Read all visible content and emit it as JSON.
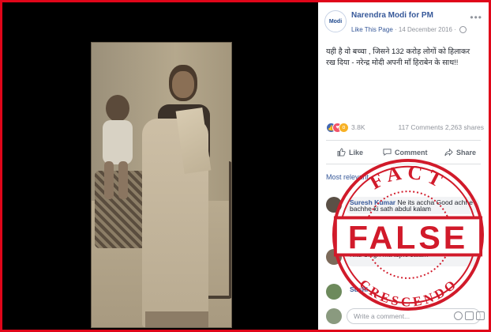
{
  "post": {
    "page_name": "Narendra Modi for PM",
    "logo_text": "Modi",
    "like_link": "Like This Page",
    "date": "· 14 December 2016 ·",
    "more_icon": "more-options-icon",
    "text": "यही है वो बच्चा , जिसने 132 करोड़ लोगों को हिलाकर रख दिया - नरेन्द्र मोदी अपनी माँ हिराबेन के साथ!!",
    "reactions": {
      "count": "3.8K",
      "stats": "117 Comments  2,263 shares"
    },
    "actions": {
      "like": "Like",
      "comment": "Comment",
      "share": "Share"
    },
    "relevant_label": "Most relevant"
  },
  "comments": [
    {
      "name": "Suresh Kumar",
      "text": "Ne its accha Good achhe bachhe ki sath abdul kalam"
    },
    {
      "name": "Nitu Singh",
      "text": "Nitu Singh Ma tujhe salam"
    },
    {
      "name": "Sushi",
      "text": ""
    }
  ],
  "comment_input": {
    "placeholder": "Write a comment..."
  },
  "stamp": {
    "top_text": "FACT",
    "main_text": "FALSE",
    "bottom_text": "CRESCENDO",
    "color": "#d11a2a"
  },
  "colors": {
    "border": "#e0061a",
    "fb_blue": "#365899"
  }
}
